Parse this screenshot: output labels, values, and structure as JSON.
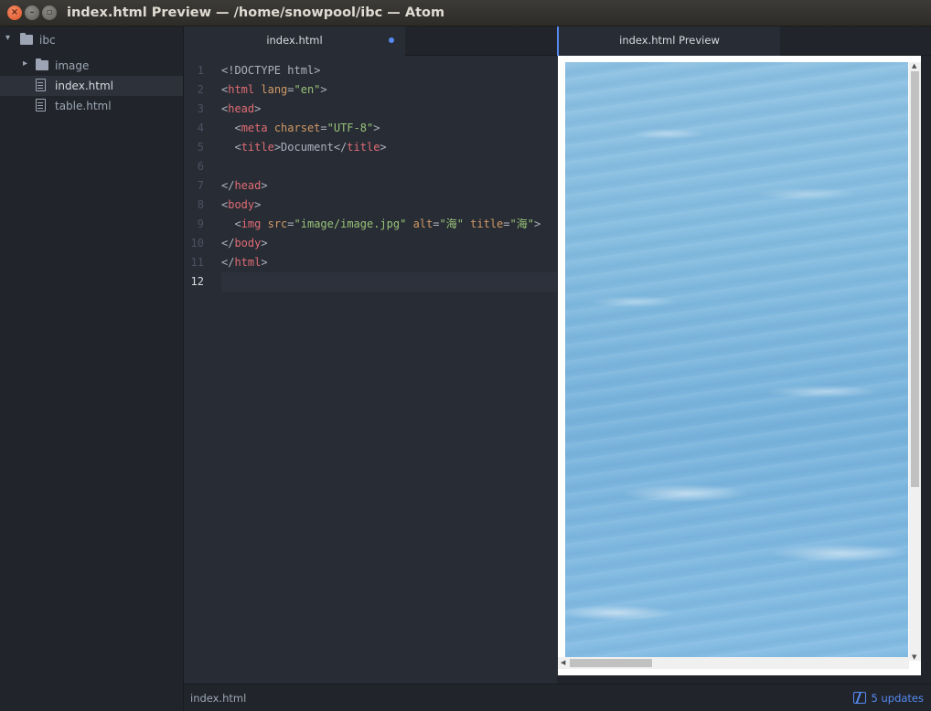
{
  "window": {
    "title": "index.html Preview — /home/snowpool/ibc — Atom"
  },
  "tree": {
    "root": "ibc",
    "items": [
      {
        "label": "image",
        "type": "folder"
      },
      {
        "label": "index.html",
        "type": "file",
        "selected": true
      },
      {
        "label": "table.html",
        "type": "file"
      }
    ]
  },
  "editor": {
    "tab": "index.html",
    "tab_modified": true,
    "line_numbers": [
      "1",
      "2",
      "3",
      "4",
      "5",
      "6",
      "7",
      "8",
      "9",
      "10",
      "11",
      "12"
    ],
    "current_line": "12",
    "lines": [
      "<!DOCTYPE html>",
      "<html lang=\"en\">",
      "<head>",
      "  <meta charset=\"UTF-8\">",
      "  <title>Document</title>",
      "",
      "</head>",
      "<body>",
      "  <img src=\"image/image.jpg\" alt=\"海\" title=\"海\">",
      "</body>",
      "</html>",
      ""
    ]
  },
  "preview": {
    "tab": "index.html Preview",
    "image_alt": "海"
  },
  "statusbar": {
    "file": "index.html",
    "updates": "5 updates"
  },
  "colors": {
    "accent": "#568af2",
    "tag": "#e06c75",
    "attr": "#d19a66",
    "string": "#98c379",
    "background": "#282c34"
  }
}
